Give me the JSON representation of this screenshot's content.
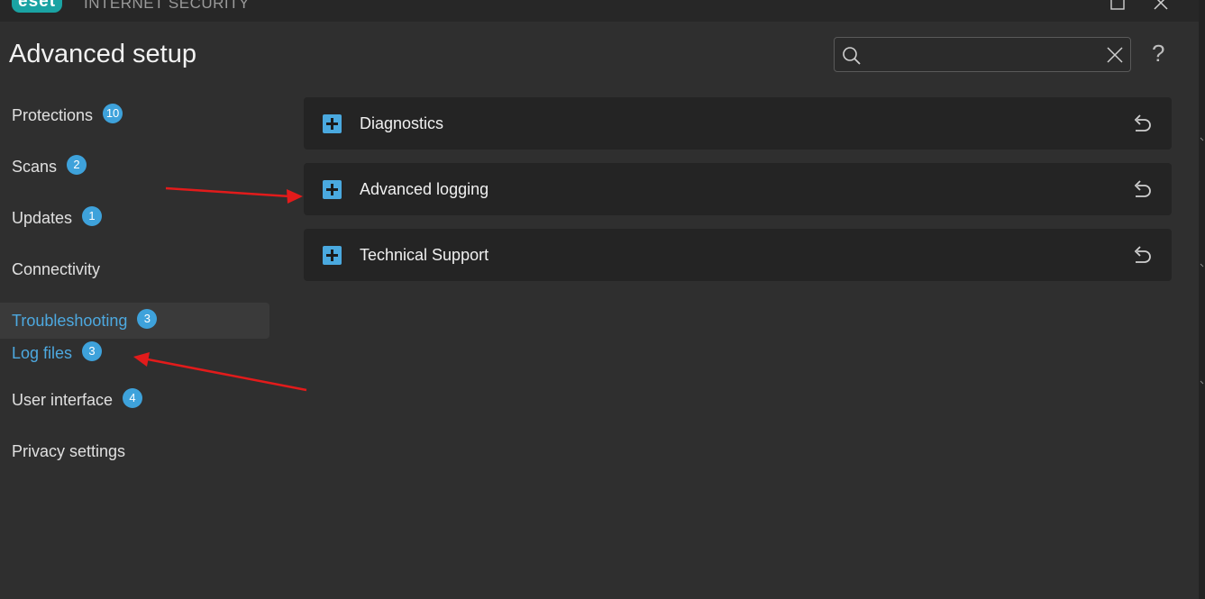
{
  "app": {
    "logo_text": "eset",
    "product_name": "INTERNET SECURITY"
  },
  "page": {
    "title": "Advanced setup"
  },
  "search": {
    "placeholder": "",
    "value": ""
  },
  "help": {
    "label": "?"
  },
  "sidebar": {
    "items": [
      {
        "label": "Protections",
        "badge": "10"
      },
      {
        "label": "Scans",
        "badge": "2"
      },
      {
        "label": "Updates",
        "badge": "1"
      },
      {
        "label": "Connectivity",
        "badge": ""
      },
      {
        "label": "Troubleshooting",
        "badge": "3"
      },
      {
        "label": "Log files",
        "badge": "3"
      },
      {
        "label": "User interface",
        "badge": "4"
      },
      {
        "label": "Privacy settings",
        "badge": ""
      }
    ]
  },
  "sections": [
    {
      "label": "Diagnostics"
    },
    {
      "label": "Advanced logging"
    },
    {
      "label": "Technical Support"
    }
  ],
  "colors": {
    "accent": "#3ea2db",
    "annotation_arrow": "#e21b1b",
    "logo": "#1aa3a3"
  }
}
